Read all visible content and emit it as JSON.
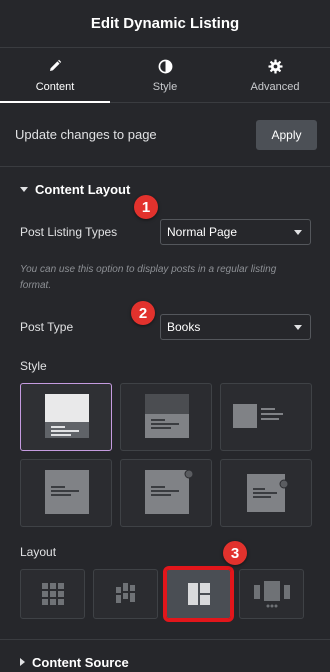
{
  "header": {
    "title": "Edit Dynamic Listing"
  },
  "tabs": [
    {
      "label": "Content",
      "icon": "pencil-icon",
      "active": true
    },
    {
      "label": "Style",
      "icon": "half-circle-icon",
      "active": false
    },
    {
      "label": "Advanced",
      "icon": "gear-icon",
      "active": false
    }
  ],
  "update": {
    "text": "Update changes to page",
    "apply_label": "Apply"
  },
  "content_layout": {
    "title": "Content Layout",
    "post_listing_types": {
      "label": "Post Listing Types",
      "value": "Normal Page"
    },
    "hint": "You can use this option to display posts in a regular listing format.",
    "post_type": {
      "label": "Post Type",
      "value": "Books"
    },
    "style_label": "Style",
    "layout_label": "Layout",
    "selected_style_index": 0,
    "selected_layout_index": 2
  },
  "badges": [
    "1",
    "2",
    "3"
  ],
  "content_source": {
    "title": "Content Source"
  },
  "colors": {
    "accent": "#c59be0",
    "badge": "#e2322d",
    "highlight": "#e2161b"
  }
}
